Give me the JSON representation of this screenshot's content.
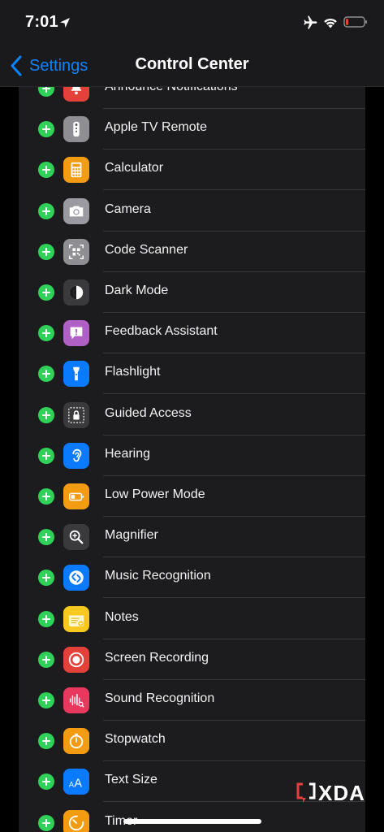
{
  "status_bar": {
    "time": "7:01",
    "icons": [
      "location-arrow-icon",
      "airplane-icon",
      "wifi-icon",
      "battery-icon"
    ]
  },
  "nav": {
    "back_label": "Settings",
    "title": "Control Center"
  },
  "colors": {
    "accent": "#0a84ff",
    "add": "#30d158",
    "panel": "#1c1c1e"
  },
  "controls": [
    {
      "label": "Announce Notifications",
      "icon": "bell-icon",
      "color": "#e5413b"
    },
    {
      "label": "Apple TV Remote",
      "icon": "remote-icon",
      "color": "#8e8e93"
    },
    {
      "label": "Calculator",
      "icon": "calculator-icon",
      "color": "#f39c12"
    },
    {
      "label": "Camera",
      "icon": "camera-icon",
      "color": "#9a9aa0"
    },
    {
      "label": "Code Scanner",
      "icon": "qr-code-icon",
      "color": "#8e8e93"
    },
    {
      "label": "Dark Mode",
      "icon": "dark-mode-icon",
      "color": "#3a3a3c"
    },
    {
      "label": "Feedback Assistant",
      "icon": "feedback-icon",
      "color": "#b05fc5"
    },
    {
      "label": "Flashlight",
      "icon": "flashlight-icon",
      "color": "#0a7aff"
    },
    {
      "label": "Guided Access",
      "icon": "lock-icon",
      "color": "#3a3a3c"
    },
    {
      "label": "Hearing",
      "icon": "ear-icon",
      "color": "#0a7aff"
    },
    {
      "label": "Low Power Mode",
      "icon": "low-battery-icon",
      "color": "#f39c12"
    },
    {
      "label": "Magnifier",
      "icon": "magnifier-icon",
      "color": "#3a3a3c"
    },
    {
      "label": "Music Recognition",
      "icon": "shazam-icon",
      "color": "#0a7aff"
    },
    {
      "label": "Notes",
      "icon": "notes-icon",
      "color": "#f7c81e"
    },
    {
      "label": "Screen Recording",
      "icon": "record-icon",
      "color": "#e5413b"
    },
    {
      "label": "Sound Recognition",
      "icon": "waveform-icon",
      "color": "#e8385d"
    },
    {
      "label": "Stopwatch",
      "icon": "stopwatch-icon",
      "color": "#f39c12"
    },
    {
      "label": "Text Size",
      "icon": "text-size-icon",
      "color": "#0a7aff"
    },
    {
      "label": "Timer",
      "icon": "timer-icon",
      "color": "#f39c12"
    }
  ],
  "watermark": {
    "text": "XDA"
  }
}
